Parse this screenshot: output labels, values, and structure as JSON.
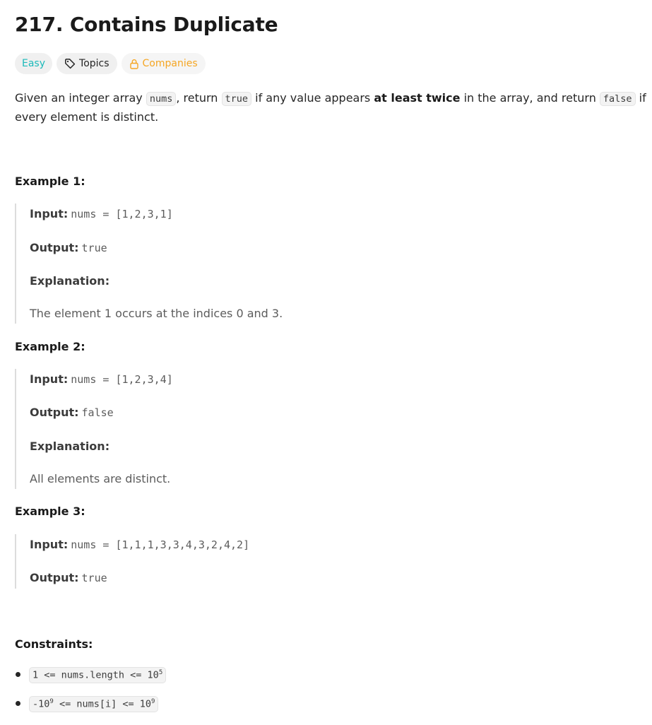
{
  "problem": {
    "title": "217. Contains Duplicate",
    "tags": {
      "difficulty": "Easy",
      "topics": "Topics",
      "companies": "Companies"
    },
    "description": {
      "part1": "Given an integer array ",
      "code1": "nums",
      "part2": ", return ",
      "code2": "true",
      "part3": " if any value appears ",
      "bold": "at least twice",
      "part4": " in the array, and return ",
      "code3": "false",
      "part5": " if every element is distinct."
    }
  },
  "examples": [
    {
      "heading": "Example 1:",
      "input_label": "Input:",
      "input_value": "nums = [1,2,3,1]",
      "output_label": "Output:",
      "output_value": "true",
      "explanation_label": "Explanation:",
      "explanation_text": "The element 1 occurs at the indices 0 and 3."
    },
    {
      "heading": "Example 2:",
      "input_label": "Input:",
      "input_value": "nums = [1,2,3,4]",
      "output_label": "Output:",
      "output_value": "false",
      "explanation_label": "Explanation:",
      "explanation_text": "All elements are distinct."
    },
    {
      "heading": "Example 3:",
      "input_label": "Input:",
      "input_value": "nums = [1,1,1,3,3,4,3,2,4,2]",
      "output_label": "Output:",
      "output_value": "true"
    }
  ],
  "constraints": {
    "heading": "Constraints:",
    "items": [
      {
        "pre": "1 <= nums.length <= 10",
        "sup": "5",
        "post": ""
      },
      {
        "pre": "-10",
        "sup": "9",
        "mid": " <= nums[i] <= 10",
        "sup2": "9"
      }
    ]
  },
  "colors": {
    "easy": "#1cbaba",
    "companies": "#f5a623",
    "text": "#262626",
    "muted": "#5c5c5c",
    "tag_bg": "#f0f0f0",
    "code_bg": "#f3f3f3",
    "block_border": "#dcdcdc"
  },
  "icons": {
    "topics": "tag-icon",
    "companies": "lock-icon"
  }
}
